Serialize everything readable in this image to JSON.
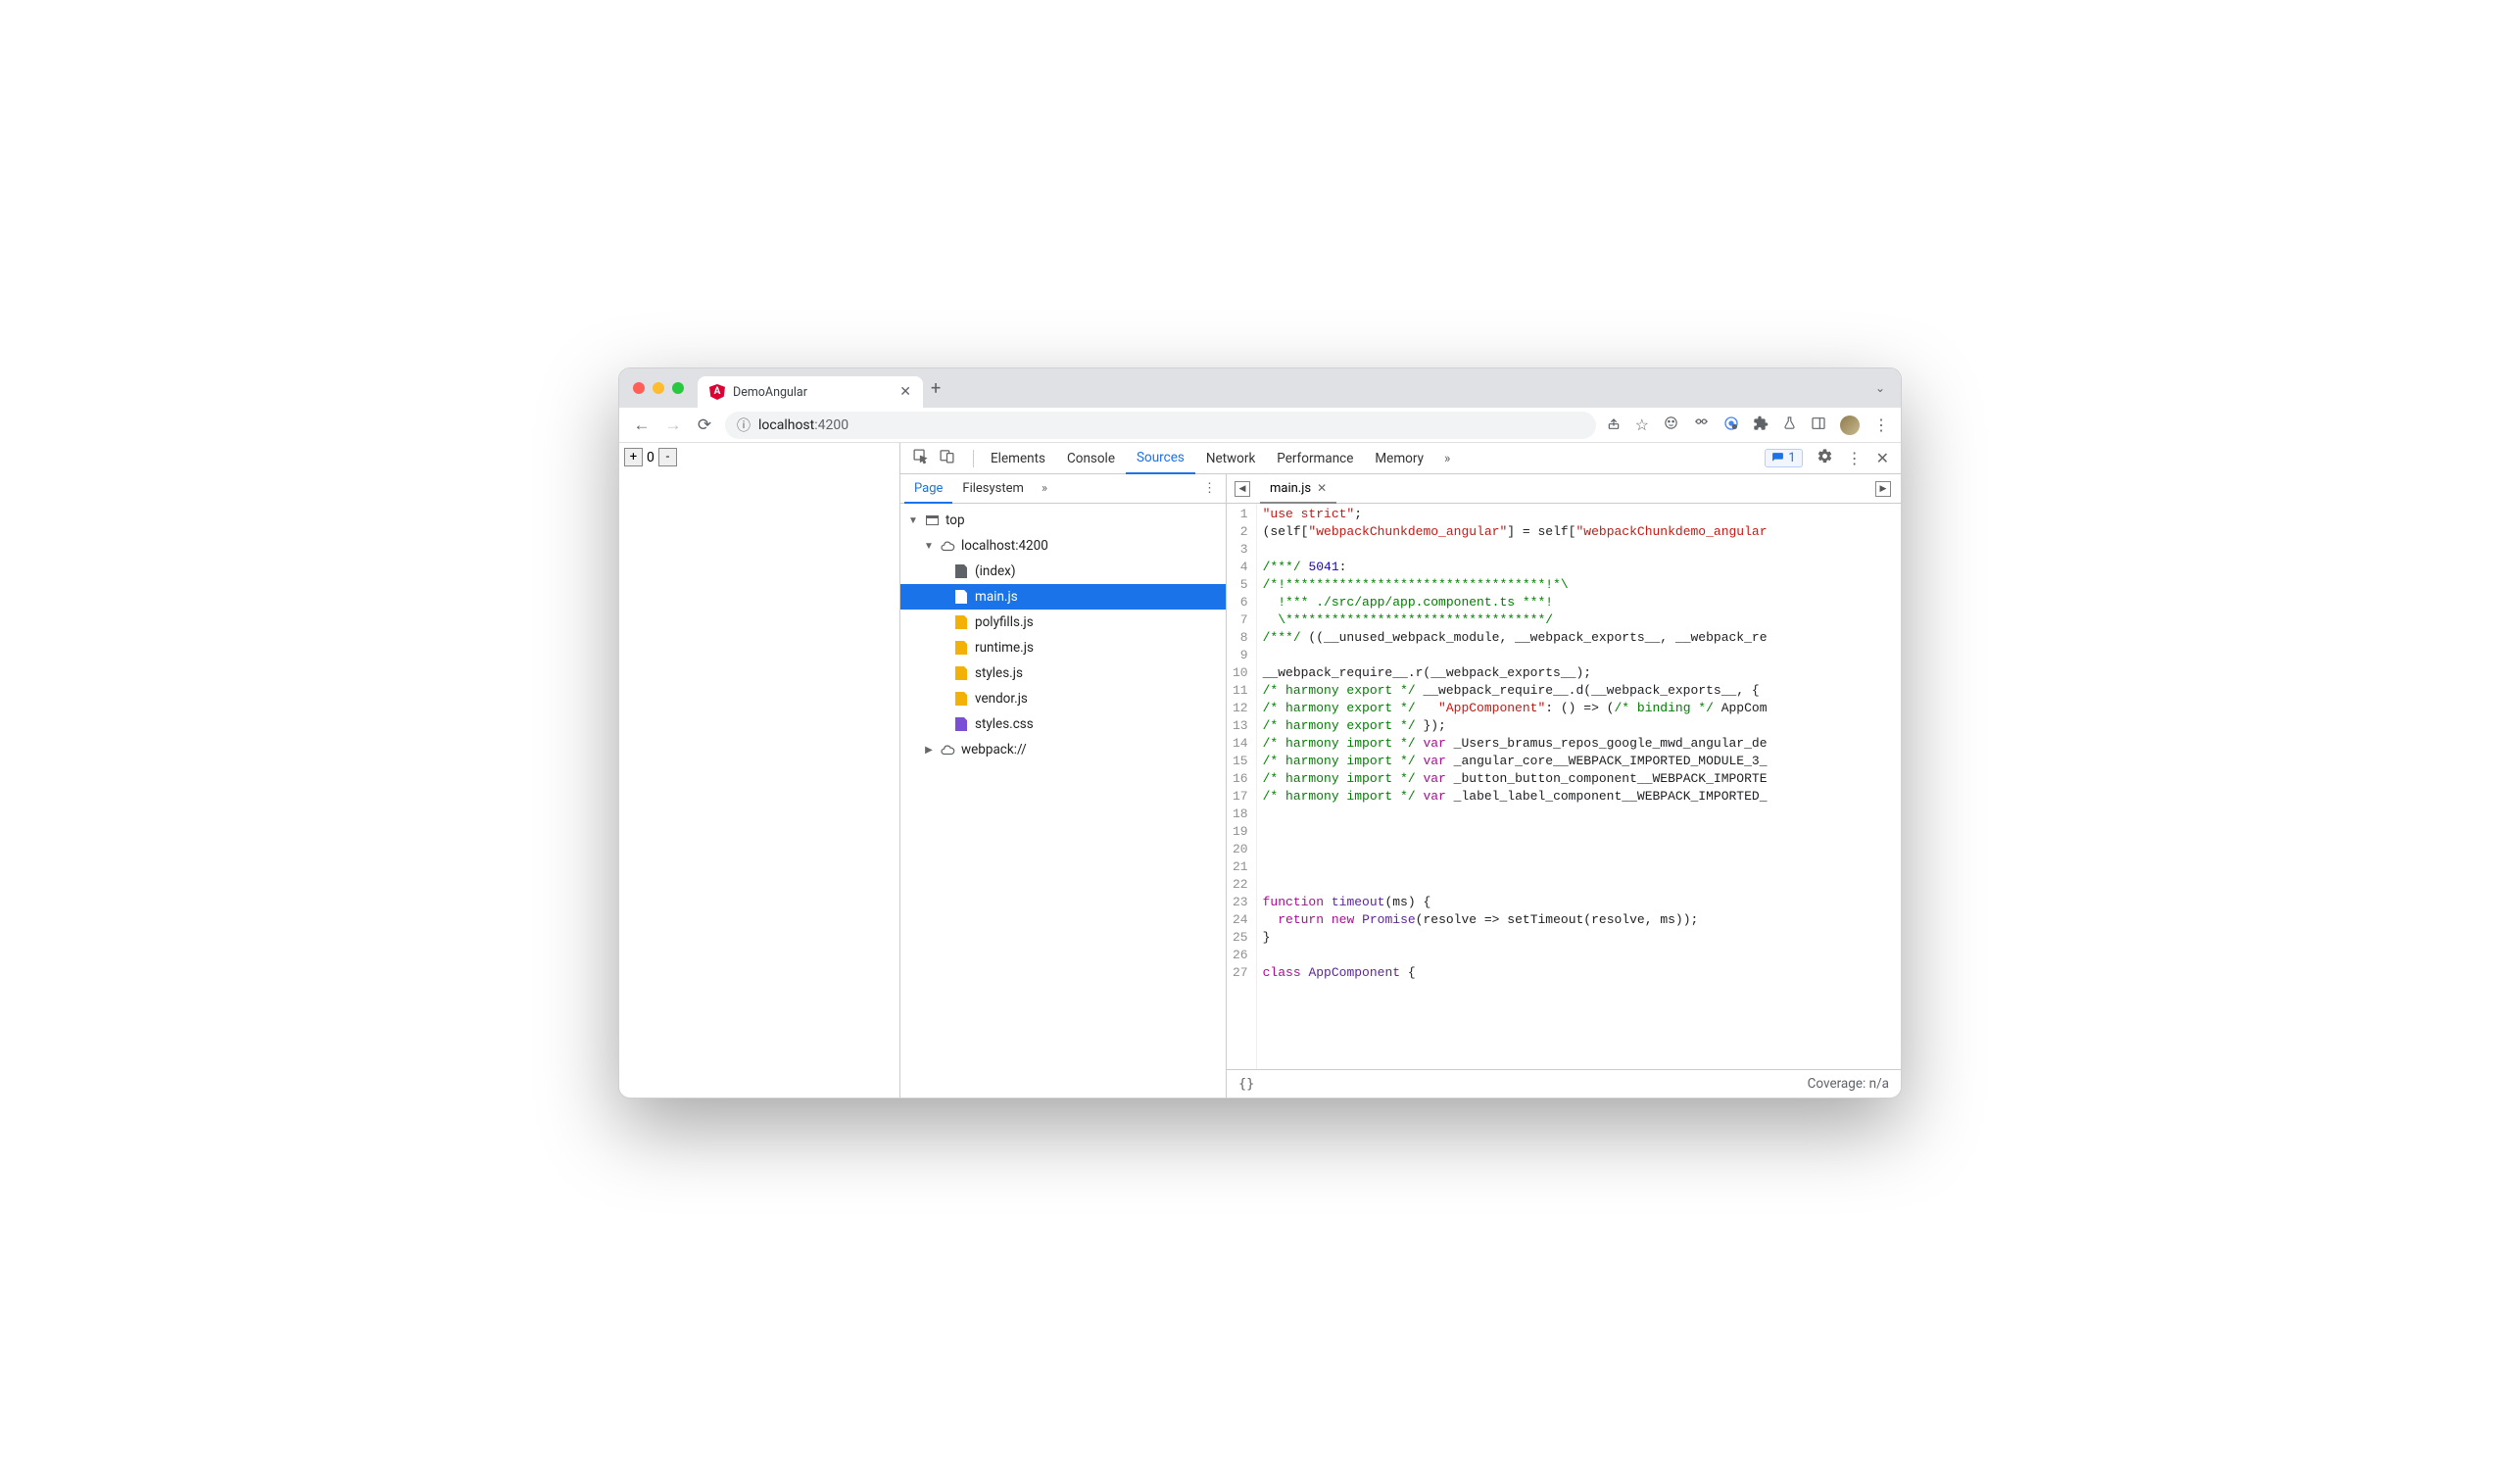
{
  "browser": {
    "tab_title": "DemoAngular",
    "url_host": "localhost",
    "url_port": ":4200"
  },
  "page": {
    "counter_value": "0",
    "plus": "+",
    "minus": "-"
  },
  "devtools": {
    "tabs": [
      "Elements",
      "Console",
      "Sources",
      "Network",
      "Performance",
      "Memory"
    ],
    "issues_count": "1"
  },
  "nav_tabs": [
    "Page",
    "Filesystem"
  ],
  "tree": {
    "top": "top",
    "origin": "localhost:4200",
    "files": [
      "(index)",
      "main.js",
      "polyfills.js",
      "runtime.js",
      "styles.js",
      "vendor.js",
      "styles.css"
    ],
    "webpack": "webpack://"
  },
  "editor": {
    "open_file": "main.js",
    "footer_braces": "{}",
    "coverage": "Coverage: n/a"
  },
  "code": [
    {
      "n": 1,
      "segs": [
        [
          "s-str",
          "\"use strict\""
        ],
        [
          "",
          ";"
        ]
      ]
    },
    {
      "n": 2,
      "segs": [
        [
          "",
          "(self["
        ],
        [
          "s-str",
          "\"webpackChunkdemo_angular\""
        ],
        [
          "",
          "] = self["
        ],
        [
          "s-str",
          "\"webpackChunkdemo_angular"
        ]
      ]
    },
    {
      "n": 3,
      "segs": [
        [
          "",
          ""
        ]
      ]
    },
    {
      "n": 4,
      "segs": [
        [
          "s-com",
          "/***/"
        ],
        [
          "",
          " "
        ],
        [
          "s-num",
          "5041"
        ],
        [
          "",
          ":"
        ]
      ]
    },
    {
      "n": 5,
      "segs": [
        [
          "s-com",
          "/*!**********************************!*\\"
        ]
      ]
    },
    {
      "n": 6,
      "segs": [
        [
          "s-com",
          "  !*** ./src/app/app.component.ts ***!"
        ]
      ]
    },
    {
      "n": 7,
      "segs": [
        [
          "s-com",
          "  \\**********************************/"
        ]
      ]
    },
    {
      "n": 8,
      "segs": [
        [
          "s-com",
          "/***/"
        ],
        [
          "",
          " ((__unused_webpack_module, __webpack_exports__, __webpack_re"
        ]
      ]
    },
    {
      "n": 9,
      "segs": [
        [
          "",
          ""
        ]
      ]
    },
    {
      "n": 10,
      "segs": [
        [
          "",
          "__webpack_require__.r(__webpack_exports__);"
        ]
      ]
    },
    {
      "n": 11,
      "segs": [
        [
          "s-com",
          "/* harmony export */"
        ],
        [
          "",
          " __webpack_require__.d(__webpack_exports__, {"
        ]
      ]
    },
    {
      "n": 12,
      "segs": [
        [
          "s-com",
          "/* harmony export */"
        ],
        [
          "",
          "   "
        ],
        [
          "s-str",
          "\"AppComponent\""
        ],
        [
          "",
          ": () => ("
        ],
        [
          "s-com",
          "/* binding */"
        ],
        [
          "",
          " AppCom"
        ]
      ]
    },
    {
      "n": 13,
      "segs": [
        [
          "s-com",
          "/* harmony export */"
        ],
        [
          "",
          " });"
        ]
      ]
    },
    {
      "n": 14,
      "segs": [
        [
          "s-com",
          "/* harmony import */"
        ],
        [
          "",
          " "
        ],
        [
          "s-kw",
          "var"
        ],
        [
          "",
          " _Users_bramus_repos_google_mwd_angular_de"
        ]
      ]
    },
    {
      "n": 15,
      "segs": [
        [
          "s-com",
          "/* harmony import */"
        ],
        [
          "",
          " "
        ],
        [
          "s-kw",
          "var"
        ],
        [
          "",
          " _angular_core__WEBPACK_IMPORTED_MODULE_3_"
        ]
      ]
    },
    {
      "n": 16,
      "segs": [
        [
          "s-com",
          "/* harmony import */"
        ],
        [
          "",
          " "
        ],
        [
          "s-kw",
          "var"
        ],
        [
          "",
          " _button_button_component__WEBPACK_IMPORTE"
        ]
      ]
    },
    {
      "n": 17,
      "segs": [
        [
          "s-com",
          "/* harmony import */"
        ],
        [
          "",
          " "
        ],
        [
          "s-kw",
          "var"
        ],
        [
          "",
          " _label_label_component__WEBPACK_IMPORTED_"
        ]
      ]
    },
    {
      "n": 18,
      "segs": [
        [
          "",
          ""
        ]
      ]
    },
    {
      "n": 19,
      "segs": [
        [
          "",
          ""
        ]
      ]
    },
    {
      "n": 20,
      "segs": [
        [
          "",
          ""
        ]
      ]
    },
    {
      "n": 21,
      "segs": [
        [
          "",
          ""
        ]
      ]
    },
    {
      "n": 22,
      "segs": [
        [
          "",
          ""
        ]
      ]
    },
    {
      "n": 23,
      "segs": [
        [
          "s-kw",
          "function"
        ],
        [
          "",
          " "
        ],
        [
          "s-fn",
          "timeout"
        ],
        [
          "",
          "(ms) {"
        ]
      ]
    },
    {
      "n": 24,
      "segs": [
        [
          "",
          "  "
        ],
        [
          "s-kw",
          "return"
        ],
        [
          "",
          " "
        ],
        [
          "s-kw",
          "new"
        ],
        [
          "",
          " "
        ],
        [
          "s-fn",
          "Promise"
        ],
        [
          "",
          "(resolve => setTimeout(resolve, ms));"
        ]
      ]
    },
    {
      "n": 25,
      "segs": [
        [
          "",
          "}"
        ]
      ]
    },
    {
      "n": 26,
      "segs": [
        [
          "",
          ""
        ]
      ]
    },
    {
      "n": 27,
      "segs": [
        [
          "s-kw",
          "class"
        ],
        [
          "",
          " "
        ],
        [
          "s-fn",
          "AppComponent"
        ],
        [
          "",
          " {"
        ]
      ]
    }
  ]
}
